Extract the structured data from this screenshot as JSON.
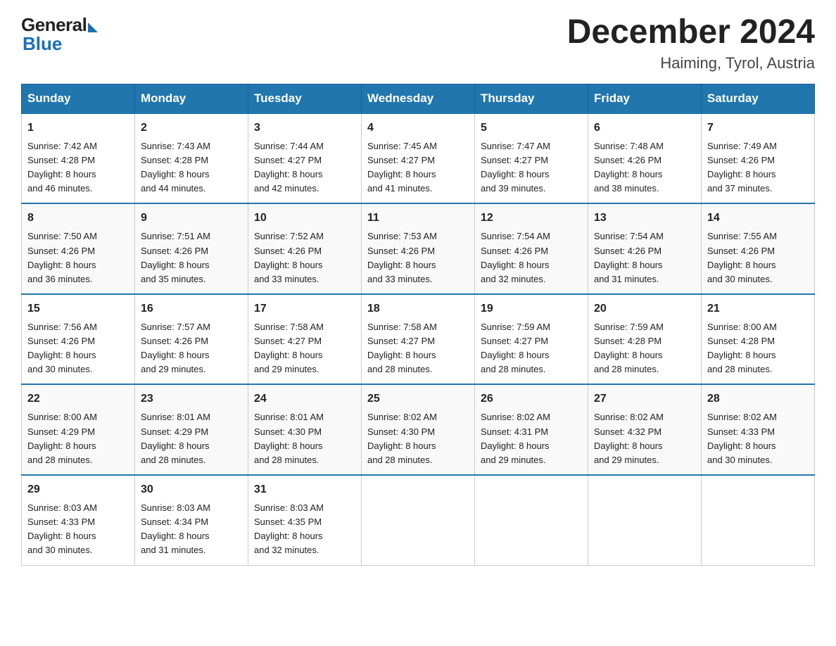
{
  "logo": {
    "general": "General",
    "blue": "Blue"
  },
  "title": "December 2024",
  "subtitle": "Haiming, Tyrol, Austria",
  "days_header": [
    "Sunday",
    "Monday",
    "Tuesday",
    "Wednesday",
    "Thursday",
    "Friday",
    "Saturday"
  ],
  "weeks": [
    [
      {
        "day": "1",
        "info": "Sunrise: 7:42 AM\nSunset: 4:28 PM\nDaylight: 8 hours\nand 46 minutes."
      },
      {
        "day": "2",
        "info": "Sunrise: 7:43 AM\nSunset: 4:28 PM\nDaylight: 8 hours\nand 44 minutes."
      },
      {
        "day": "3",
        "info": "Sunrise: 7:44 AM\nSunset: 4:27 PM\nDaylight: 8 hours\nand 42 minutes."
      },
      {
        "day": "4",
        "info": "Sunrise: 7:45 AM\nSunset: 4:27 PM\nDaylight: 8 hours\nand 41 minutes."
      },
      {
        "day": "5",
        "info": "Sunrise: 7:47 AM\nSunset: 4:27 PM\nDaylight: 8 hours\nand 39 minutes."
      },
      {
        "day": "6",
        "info": "Sunrise: 7:48 AM\nSunset: 4:26 PM\nDaylight: 8 hours\nand 38 minutes."
      },
      {
        "day": "7",
        "info": "Sunrise: 7:49 AM\nSunset: 4:26 PM\nDaylight: 8 hours\nand 37 minutes."
      }
    ],
    [
      {
        "day": "8",
        "info": "Sunrise: 7:50 AM\nSunset: 4:26 PM\nDaylight: 8 hours\nand 36 minutes."
      },
      {
        "day": "9",
        "info": "Sunrise: 7:51 AM\nSunset: 4:26 PM\nDaylight: 8 hours\nand 35 minutes."
      },
      {
        "day": "10",
        "info": "Sunrise: 7:52 AM\nSunset: 4:26 PM\nDaylight: 8 hours\nand 33 minutes."
      },
      {
        "day": "11",
        "info": "Sunrise: 7:53 AM\nSunset: 4:26 PM\nDaylight: 8 hours\nand 33 minutes."
      },
      {
        "day": "12",
        "info": "Sunrise: 7:54 AM\nSunset: 4:26 PM\nDaylight: 8 hours\nand 32 minutes."
      },
      {
        "day": "13",
        "info": "Sunrise: 7:54 AM\nSunset: 4:26 PM\nDaylight: 8 hours\nand 31 minutes."
      },
      {
        "day": "14",
        "info": "Sunrise: 7:55 AM\nSunset: 4:26 PM\nDaylight: 8 hours\nand 30 minutes."
      }
    ],
    [
      {
        "day": "15",
        "info": "Sunrise: 7:56 AM\nSunset: 4:26 PM\nDaylight: 8 hours\nand 30 minutes."
      },
      {
        "day": "16",
        "info": "Sunrise: 7:57 AM\nSunset: 4:26 PM\nDaylight: 8 hours\nand 29 minutes."
      },
      {
        "day": "17",
        "info": "Sunrise: 7:58 AM\nSunset: 4:27 PM\nDaylight: 8 hours\nand 29 minutes."
      },
      {
        "day": "18",
        "info": "Sunrise: 7:58 AM\nSunset: 4:27 PM\nDaylight: 8 hours\nand 28 minutes."
      },
      {
        "day": "19",
        "info": "Sunrise: 7:59 AM\nSunset: 4:27 PM\nDaylight: 8 hours\nand 28 minutes."
      },
      {
        "day": "20",
        "info": "Sunrise: 7:59 AM\nSunset: 4:28 PM\nDaylight: 8 hours\nand 28 minutes."
      },
      {
        "day": "21",
        "info": "Sunrise: 8:00 AM\nSunset: 4:28 PM\nDaylight: 8 hours\nand 28 minutes."
      }
    ],
    [
      {
        "day": "22",
        "info": "Sunrise: 8:00 AM\nSunset: 4:29 PM\nDaylight: 8 hours\nand 28 minutes."
      },
      {
        "day": "23",
        "info": "Sunrise: 8:01 AM\nSunset: 4:29 PM\nDaylight: 8 hours\nand 28 minutes."
      },
      {
        "day": "24",
        "info": "Sunrise: 8:01 AM\nSunset: 4:30 PM\nDaylight: 8 hours\nand 28 minutes."
      },
      {
        "day": "25",
        "info": "Sunrise: 8:02 AM\nSunset: 4:30 PM\nDaylight: 8 hours\nand 28 minutes."
      },
      {
        "day": "26",
        "info": "Sunrise: 8:02 AM\nSunset: 4:31 PM\nDaylight: 8 hours\nand 29 minutes."
      },
      {
        "day": "27",
        "info": "Sunrise: 8:02 AM\nSunset: 4:32 PM\nDaylight: 8 hours\nand 29 minutes."
      },
      {
        "day": "28",
        "info": "Sunrise: 8:02 AM\nSunset: 4:33 PM\nDaylight: 8 hours\nand 30 minutes."
      }
    ],
    [
      {
        "day": "29",
        "info": "Sunrise: 8:03 AM\nSunset: 4:33 PM\nDaylight: 8 hours\nand 30 minutes."
      },
      {
        "day": "30",
        "info": "Sunrise: 8:03 AM\nSunset: 4:34 PM\nDaylight: 8 hours\nand 31 minutes."
      },
      {
        "day": "31",
        "info": "Sunrise: 8:03 AM\nSunset: 4:35 PM\nDaylight: 8 hours\nand 32 minutes."
      },
      {
        "day": "",
        "info": ""
      },
      {
        "day": "",
        "info": ""
      },
      {
        "day": "",
        "info": ""
      },
      {
        "day": "",
        "info": ""
      }
    ]
  ]
}
